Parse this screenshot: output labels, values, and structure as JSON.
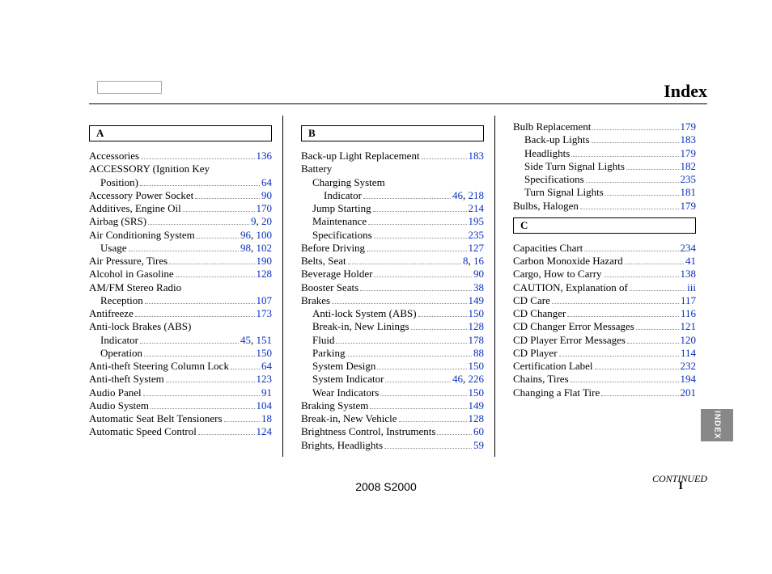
{
  "title": "Index",
  "footer_text": "2008  S2000",
  "page_num": "I",
  "side_tab": "INDEX",
  "continued": "CONTINUED",
  "link_color": "#0a2fbf",
  "columns": [
    {
      "blocks": [
        {
          "type": "header",
          "label": "A"
        },
        {
          "type": "entry",
          "indent": 0,
          "label": "Accessories",
          "pages": [
            "136"
          ]
        },
        {
          "type": "entry",
          "indent": 0,
          "label": "ACCESSORY (Ignition Key",
          "pages": []
        },
        {
          "type": "entry",
          "indent": 1,
          "label": "Position)",
          "pages": [
            "64"
          ]
        },
        {
          "type": "entry",
          "indent": 0,
          "label": "Accessory Power Socket",
          "pages": [
            "90"
          ]
        },
        {
          "type": "entry",
          "indent": 0,
          "label": "Additives, Engine Oil",
          "pages": [
            "170"
          ]
        },
        {
          "type": "entry",
          "indent": 0,
          "label": "Airbag (SRS)",
          "pages": [
            "9",
            "20"
          ]
        },
        {
          "type": "entry",
          "indent": 0,
          "label": "Air Conditioning System",
          "pages": [
            "96",
            "100"
          ]
        },
        {
          "type": "entry",
          "indent": 1,
          "label": "Usage",
          "pages": [
            "98",
            "102"
          ]
        },
        {
          "type": "entry",
          "indent": 0,
          "label": "Air Pressure, Tires",
          "pages": [
            "190"
          ]
        },
        {
          "type": "entry",
          "indent": 0,
          "label": "Alcohol in Gasoline",
          "pages": [
            "128"
          ]
        },
        {
          "type": "entry",
          "indent": 0,
          "label": "AM/FM Stereo Radio",
          "pages": []
        },
        {
          "type": "entry",
          "indent": 1,
          "label": "Reception",
          "pages": [
            "107"
          ]
        },
        {
          "type": "entry",
          "indent": 0,
          "label": "Antifreeze",
          "pages": [
            "173"
          ]
        },
        {
          "type": "entry",
          "indent": 0,
          "label": "Anti-lock Brakes (ABS)",
          "pages": []
        },
        {
          "type": "entry",
          "indent": 1,
          "label": "Indicator",
          "pages": [
            "45",
            "151"
          ]
        },
        {
          "type": "entry",
          "indent": 1,
          "label": "Operation",
          "pages": [
            "150"
          ]
        },
        {
          "type": "entry",
          "indent": 0,
          "label": "Anti-theft Steering Column Lock",
          "pages": [
            "64"
          ]
        },
        {
          "type": "entry",
          "indent": 0,
          "label": "Anti-theft System",
          "pages": [
            "123"
          ]
        },
        {
          "type": "entry",
          "indent": 0,
          "label": "Audio Panel",
          "pages": [
            "91"
          ]
        },
        {
          "type": "entry",
          "indent": 0,
          "label": "Audio System",
          "pages": [
            "104"
          ]
        },
        {
          "type": "entry",
          "indent": 0,
          "label": "Automatic Seat Belt Tensioners",
          "pages": [
            "18"
          ]
        },
        {
          "type": "entry",
          "indent": 0,
          "label": "Automatic Speed Control",
          "pages": [
            "124"
          ]
        }
      ]
    },
    {
      "blocks": [
        {
          "type": "header",
          "label": "B"
        },
        {
          "type": "entry",
          "indent": 0,
          "label": "Back-up Light Replacement",
          "pages": [
            "183"
          ]
        },
        {
          "type": "entry",
          "indent": 0,
          "label": "Battery",
          "pages": []
        },
        {
          "type": "entry",
          "indent": 1,
          "label": "Charging System",
          "pages": []
        },
        {
          "type": "entry",
          "indent": 2,
          "label": "Indicator",
          "pages": [
            "46",
            "218"
          ]
        },
        {
          "type": "entry",
          "indent": 1,
          "label": "Jump Starting",
          "pages": [
            "214"
          ]
        },
        {
          "type": "entry",
          "indent": 1,
          "label": "Maintenance",
          "pages": [
            "195"
          ]
        },
        {
          "type": "entry",
          "indent": 1,
          "label": "Specifications",
          "pages": [
            "235"
          ]
        },
        {
          "type": "entry",
          "indent": 0,
          "label": "Before Driving",
          "pages": [
            "127"
          ]
        },
        {
          "type": "entry",
          "indent": 0,
          "label": "Belts, Seat",
          "pages": [
            "8",
            "16"
          ]
        },
        {
          "type": "entry",
          "indent": 0,
          "label": "Beverage Holder",
          "pages": [
            "90"
          ]
        },
        {
          "type": "entry",
          "indent": 0,
          "label": "Booster Seats",
          "pages": [
            "38"
          ]
        },
        {
          "type": "entry",
          "indent": 0,
          "label": "Brakes",
          "pages": [
            "149"
          ]
        },
        {
          "type": "entry",
          "indent": 1,
          "label": "Anti-lock System (ABS)",
          "pages": [
            "150"
          ]
        },
        {
          "type": "entry",
          "indent": 1,
          "label": "Break-in, New Linings",
          "pages": [
            "128"
          ]
        },
        {
          "type": "entry",
          "indent": 1,
          "label": "Fluid",
          "pages": [
            "178"
          ]
        },
        {
          "type": "entry",
          "indent": 1,
          "label": "Parking",
          "pages": [
            "88"
          ]
        },
        {
          "type": "entry",
          "indent": 1,
          "label": "System Design",
          "pages": [
            "150"
          ]
        },
        {
          "type": "entry",
          "indent": 1,
          "label": "System Indicator",
          "pages": [
            "46",
            "226"
          ]
        },
        {
          "type": "entry",
          "indent": 1,
          "label": "Wear Indicators",
          "pages": [
            "150"
          ]
        },
        {
          "type": "entry",
          "indent": 0,
          "label": "Braking System",
          "pages": [
            "149"
          ]
        },
        {
          "type": "entry",
          "indent": 0,
          "label": "Break-in, New Vehicle",
          "pages": [
            "128"
          ]
        },
        {
          "type": "entry",
          "indent": 0,
          "label": "Brightness Control, Instruments",
          "pages": [
            "60"
          ]
        },
        {
          "type": "entry",
          "indent": 0,
          "label": "Brights, Headlights",
          "pages": [
            "59"
          ]
        }
      ]
    },
    {
      "blocks": [
        {
          "type": "entry",
          "indent": 0,
          "label": "Bulb Replacement",
          "pages": [
            "179"
          ]
        },
        {
          "type": "entry",
          "indent": 1,
          "label": "Back-up Lights",
          "pages": [
            "183"
          ]
        },
        {
          "type": "entry",
          "indent": 1,
          "label": "Headlights",
          "pages": [
            "179"
          ]
        },
        {
          "type": "entry",
          "indent": 1,
          "label": "Side Turn Signal Lights",
          "pages": [
            "182"
          ]
        },
        {
          "type": "entry",
          "indent": 1,
          "label": "Specifications",
          "pages": [
            "235"
          ]
        },
        {
          "type": "entry",
          "indent": 1,
          "label": "Turn Signal Lights",
          "pages": [
            "181"
          ]
        },
        {
          "type": "entry",
          "indent": 0,
          "label": "Bulbs, Halogen",
          "pages": [
            "179"
          ]
        },
        {
          "type": "header",
          "label": "C"
        },
        {
          "type": "entry",
          "indent": 0,
          "label": "Capacities Chart",
          "pages": [
            "234"
          ]
        },
        {
          "type": "entry",
          "indent": 0,
          "label": "Carbon Monoxide Hazard",
          "pages": [
            "41"
          ]
        },
        {
          "type": "entry",
          "indent": 0,
          "label": "Cargo, How to Carry",
          "pages": [
            "138"
          ]
        },
        {
          "type": "entry",
          "indent": 0,
          "label": "CAUTION, Explanation of",
          "pages": [
            "iii"
          ]
        },
        {
          "type": "entry",
          "indent": 0,
          "label": "CD Care",
          "pages": [
            "117"
          ]
        },
        {
          "type": "entry",
          "indent": 0,
          "label": "CD Changer",
          "pages": [
            "116"
          ]
        },
        {
          "type": "entry",
          "indent": 0,
          "label": "CD Changer Error Messages",
          "pages": [
            "121"
          ]
        },
        {
          "type": "entry",
          "indent": 0,
          "label": "CD Player Error Messages",
          "pages": [
            "120"
          ]
        },
        {
          "type": "entry",
          "indent": 0,
          "label": "CD Player",
          "pages": [
            "114"
          ]
        },
        {
          "type": "entry",
          "indent": 0,
          "label": "Certification Label",
          "pages": [
            "232"
          ]
        },
        {
          "type": "entry",
          "indent": 0,
          "label": "Chains, Tires",
          "pages": [
            "194"
          ]
        },
        {
          "type": "entry",
          "indent": 0,
          "label": "Changing a Flat Tire",
          "pages": [
            "201"
          ]
        }
      ]
    }
  ]
}
